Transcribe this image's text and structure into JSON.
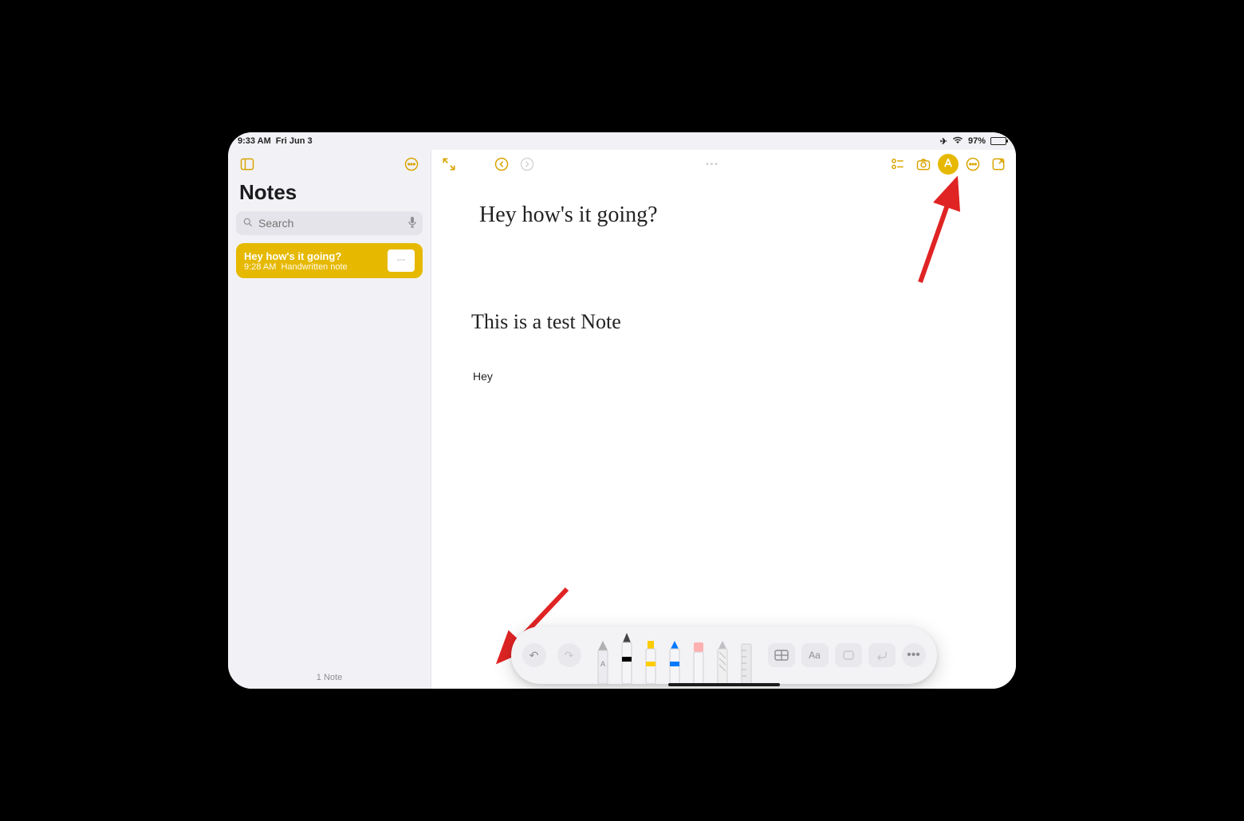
{
  "statusbar": {
    "time": "9:33 AM",
    "date": "Fri Jun 3",
    "airplane_icon": "airplane",
    "wifi_icon": "wifi",
    "battery_pct": "97%",
    "battery_fill_pct": 97
  },
  "sidebar": {
    "title": "Notes",
    "search_placeholder": "Search",
    "footer": "1 Note",
    "note": {
      "title": "Hey how's it going?",
      "time": "9:28 AM",
      "subtitle": "Handwritten note"
    }
  },
  "canvas": {
    "handwriting_line1": "Hey how's it going?",
    "handwriting_line2": "This is a test Note",
    "typed_text": "Hey"
  },
  "palette": {
    "tools": [
      {
        "name": "scribble-pen",
        "label": "A"
      },
      {
        "name": "pen",
        "color": "#000000",
        "selected": true
      },
      {
        "name": "marker",
        "color": "#ffcc00"
      },
      {
        "name": "pencil",
        "color": "#007aff"
      },
      {
        "name": "eraser",
        "color": "#ff9999"
      },
      {
        "name": "lasso",
        "color": "#cccccc"
      },
      {
        "name": "ruler",
        "color": "#bbbbbb"
      }
    ],
    "aa_label": "Aa"
  },
  "colors": {
    "accent": "#e6b900",
    "toolbar_icon": "#d9a400"
  },
  "annotations": {
    "arrow_to_markup_icon": true,
    "arrow_to_pen_tool": true
  }
}
